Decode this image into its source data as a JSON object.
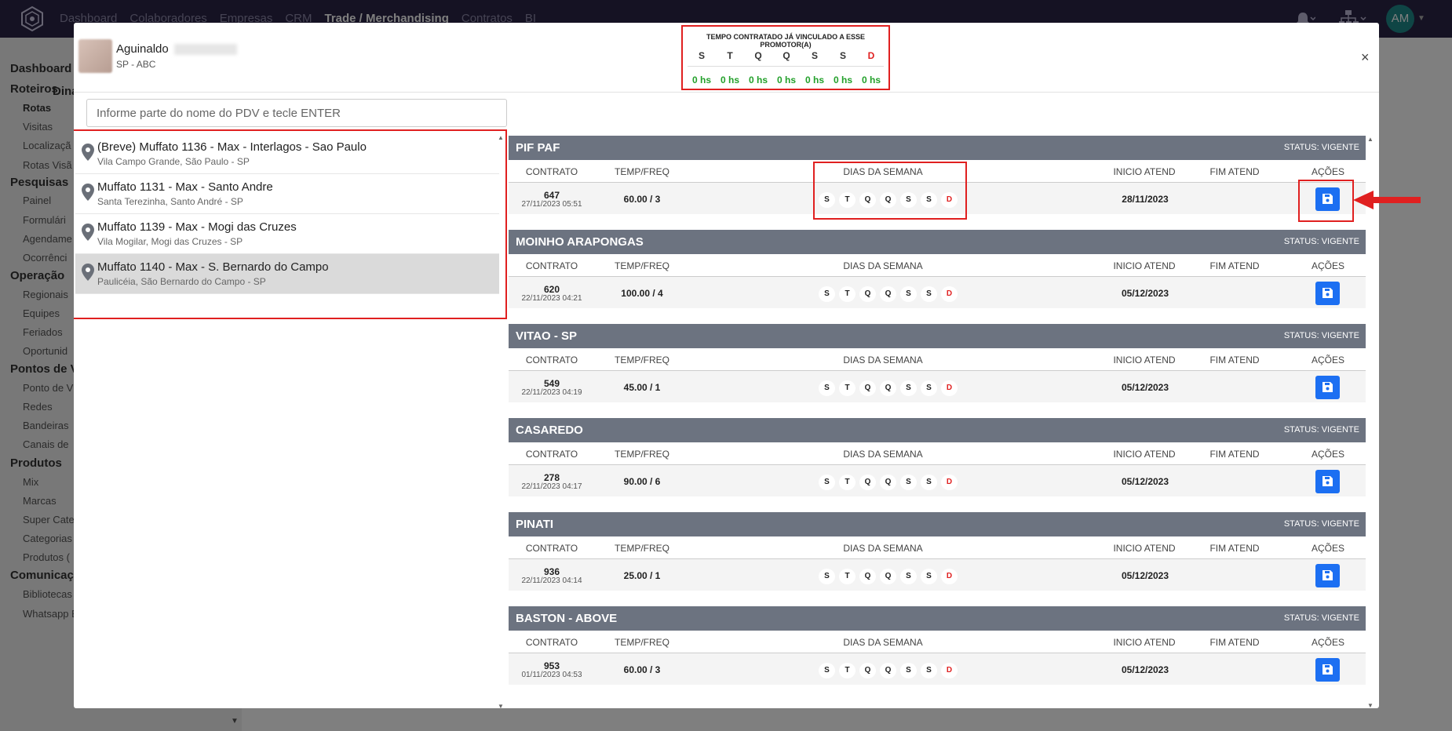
{
  "topnav": {
    "menu": [
      "Dashboard",
      "Colaboradores",
      "Empresas",
      "CRM",
      "Trade / Merchandising",
      "Contratos",
      "BI"
    ],
    "active_index": 4,
    "avatar_initials": "AM"
  },
  "sidebar": {
    "page_title_partial": "Dina",
    "sections": [
      {
        "label": "Dashboard",
        "items": []
      },
      {
        "label": "Roteiros",
        "items": [
          "Rotas",
          "Visitas",
          "Localizaçã",
          "Rotas Visã"
        ]
      },
      {
        "label": "Pesquisas",
        "items": [
          "Painel",
          "Formulári",
          "Agendame",
          "Ocorrênci"
        ]
      },
      {
        "label": "Operação",
        "items": [
          "Regionais",
          "Equipes",
          "Feriados",
          "Oportunid"
        ]
      },
      {
        "label": "Pontos de Ve",
        "items": [
          "Ponto de V",
          "Redes",
          "Bandeiras",
          "Canais de"
        ]
      },
      {
        "label": "Produtos",
        "items": [
          "Mix",
          "Marcas",
          "Super Cate",
          "Categorias",
          "Produtos ("
        ]
      },
      {
        "label": "Comunicaç",
        "items": [
          "Bibliotecas",
          "Whatsapp Booking"
        ]
      }
    ]
  },
  "modal": {
    "user": {
      "name": "Aguinaldo",
      "location": "SP - ABC"
    },
    "tempo": {
      "title": "TEMPO CONTRATADO JÁ VINCULADO A ESSE PROMOTOR(A)",
      "days": [
        "S",
        "T",
        "Q",
        "Q",
        "S",
        "S",
        "D"
      ],
      "hours": [
        "0 hs",
        "0 hs",
        "0 hs",
        "0 hs",
        "0 hs",
        "0 hs",
        "0 hs"
      ]
    },
    "close_label": "×",
    "search_placeholder": "Informe parte do nome do PDV e tecle ENTER",
    "pdvs": [
      {
        "title": "(Breve) Muffato 1136 - Max - Interlagos - Sao Paulo",
        "subtitle": "Vila Campo Grande, São Paulo - SP"
      },
      {
        "title": "Muffato 1131 - Max - Santo Andre",
        "subtitle": "Santa Terezinha, Santo André - SP"
      },
      {
        "title": "Muffato 1139 - Max - Mogi das Cruzes",
        "subtitle": "Vila Mogilar, Mogi das Cruzes - SP"
      },
      {
        "title": "Muffato 1140 - Max - S. Bernardo do Campo",
        "subtitle": "Paulicéia, São Bernardo do Campo - SP"
      }
    ],
    "selected_pdv_index": 3,
    "columns": {
      "contrato": "CONTRATO",
      "temp_freq": "TEMP/FREQ",
      "dias": "DIAS DA SEMANA",
      "inicio": "INICIO ATEND",
      "fim": "FIM ATEND",
      "acoes": "AÇÕES"
    },
    "weekdays": [
      "S",
      "T",
      "Q",
      "Q",
      "S",
      "S",
      "D"
    ],
    "contracts": [
      {
        "name": "PIF PAF",
        "status": "STATUS: VIGENTE",
        "number": "647",
        "date": "27/11/2023 05:51",
        "freq": "60.00 / 3",
        "start": "28/11/2023",
        "end": ""
      },
      {
        "name": "MOINHO ARAPONGAS",
        "status": "STATUS: VIGENTE",
        "number": "620",
        "date": "22/11/2023 04:21",
        "freq": "100.00 / 4",
        "start": "05/12/2023",
        "end": ""
      },
      {
        "name": "VITAO - SP",
        "status": "STATUS: VIGENTE",
        "number": "549",
        "date": "22/11/2023 04:19",
        "freq": "45.00 / 1",
        "start": "05/12/2023",
        "end": ""
      },
      {
        "name": "CASAREDO",
        "status": "STATUS: VIGENTE",
        "number": "278",
        "date": "22/11/2023 04:17",
        "freq": "90.00 / 6",
        "start": "05/12/2023",
        "end": ""
      },
      {
        "name": "PINATI",
        "status": "STATUS: VIGENTE",
        "number": "936",
        "date": "22/11/2023 04:14",
        "freq": "25.00 / 1",
        "start": "05/12/2023",
        "end": ""
      },
      {
        "name": "BASTON - ABOVE",
        "status": "STATUS: VIGENTE",
        "number": "953",
        "date": "01/11/2023 04:53",
        "freq": "60.00 / 3",
        "start": "05/12/2023",
        "end": ""
      }
    ]
  },
  "colors": {
    "accent": "#1c6ff2",
    "annotation": "#e02020",
    "nav": "#2a2547",
    "group_header": "#6c7380",
    "hours_green": "#22a02a"
  }
}
